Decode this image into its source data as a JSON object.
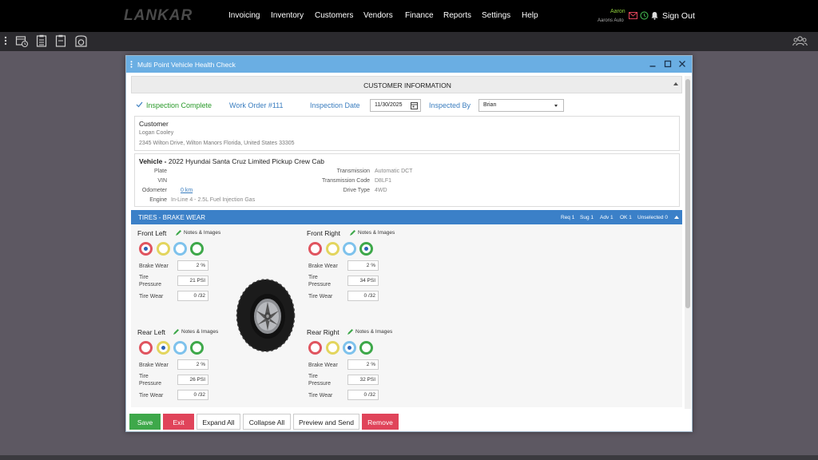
{
  "app": {
    "logo": "LANKAR",
    "nav": [
      "Invoicing",
      "Inventory",
      "Customers",
      "Vendors",
      "Finance",
      "Reports",
      "Settings",
      "Help"
    ],
    "user": {
      "name": "Aaron",
      "company": "Aarons Auto"
    },
    "signout_label": "Sign Out"
  },
  "dialog": {
    "title": "Multi Point Vehicle Health Check",
    "customer_info_header": "CUSTOMER INFORMATION",
    "inspection_complete": "Inspection Complete",
    "work_order": "Work Order #111",
    "inspection_date_label": "Inspection Date",
    "inspection_date": "11/30/2025",
    "inspected_by_label": "Inspected By",
    "inspected_by": "Brian",
    "customer": {
      "title": "Customer",
      "name": "Logan Cooley",
      "address": "2345 Wilton Drive, Wilton Manors Florida, United States 33305"
    },
    "vehicle": {
      "title_prefix": "Vehicle -",
      "title": "2022 Hyundai Santa Cruz Limited Pickup Crew Cab",
      "plate_label": "Plate",
      "plate": "",
      "vin_label": "VIN",
      "vin": "",
      "odometer_label": "Odometer",
      "odometer": "0 km",
      "engine_label": "Engine",
      "engine": "In-Line 4 - 2.5L Fuel Injection Gas",
      "transmission_label": "Transmission",
      "transmission": "Automatic DCT",
      "transmission_code_label": "Transmission Code",
      "transmission_code": "D8LF1",
      "drive_type_label": "Drive Type",
      "drive_type": "4WD"
    },
    "tires_section": {
      "title": "TIRES - BRAKE WEAR",
      "stats": [
        "Req 1",
        "Sug 1",
        "Adv 1",
        "OK 1",
        "Unselected 0"
      ],
      "notes_label": "Notes & Images",
      "brake_wear_label": "Brake Wear",
      "tire_pressure_label_1": "Tire",
      "tire_pressure_label_2": "Pressure",
      "tire_wear_label": "Tire Wear",
      "positions": {
        "front_left": {
          "title": "Front Left",
          "selected": "green",
          "brake_wear": "2 %",
          "tire_pressure": "21 PSI",
          "tire_wear": "0 /32"
        },
        "front_right": {
          "title": "Front Right",
          "selected": "green",
          "brake_wear": "2 %",
          "tire_pressure": "34 PSI",
          "tire_wear": "0 /32"
        },
        "rear_left": {
          "title": "Rear Left",
          "selected": "yellow",
          "brake_wear": "2 %",
          "tire_pressure": "26 PSI",
          "tire_wear": "0 /32"
        },
        "rear_right": {
          "title": "Rear Right",
          "selected": "blue",
          "brake_wear": "2 %",
          "tire_pressure": "32 PSI",
          "tire_wear": "0 /32"
        }
      }
    },
    "buttons": {
      "save": "Save",
      "exit": "Exit",
      "expand_all": "Expand All",
      "collapse_all": "Collapse All",
      "preview_send": "Preview and Send",
      "remove": "Remove"
    }
  },
  "colors": {
    "accent_blue": "#3b80c8",
    "title_blue": "#6aaee3",
    "green": "#3ea84a",
    "red": "#e0445a",
    "req": "#e0545f",
    "sug": "#e3d55e",
    "adv": "#7ec2ec",
    "ok": "#3ea84a"
  }
}
